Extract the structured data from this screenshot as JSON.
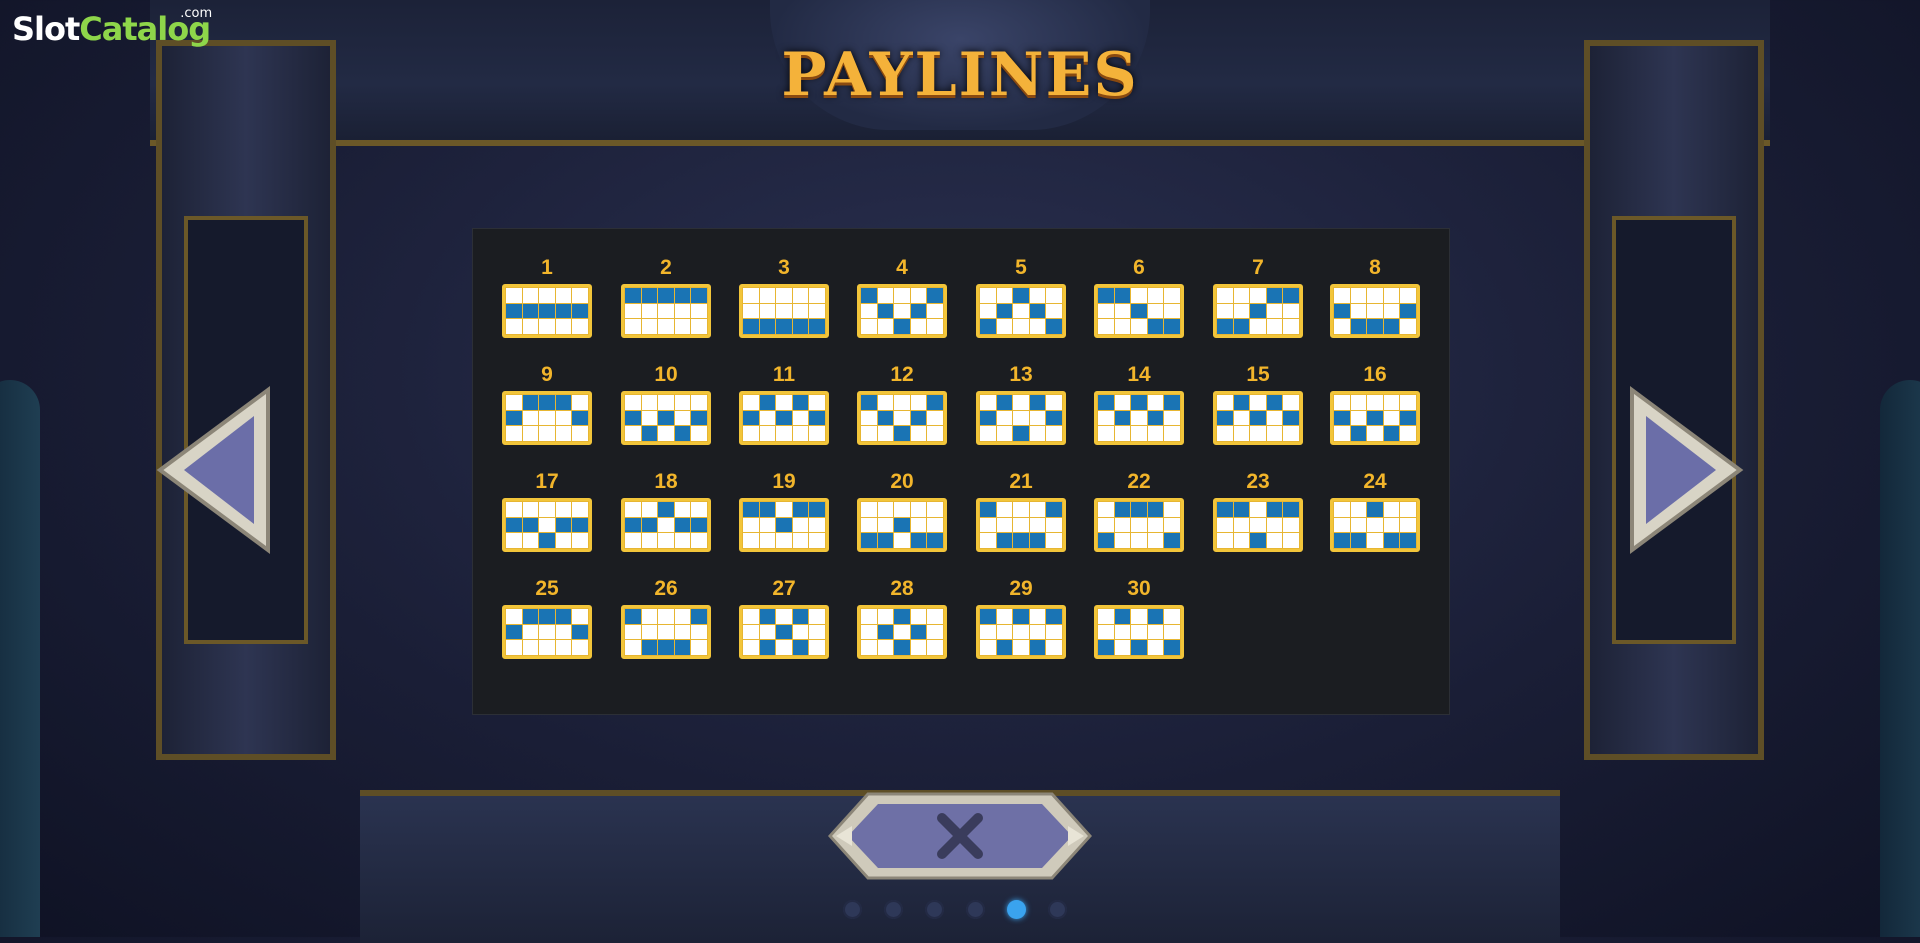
{
  "logo": {
    "part1": "Slot",
    "part2": "Catalog",
    "suffix": ".com"
  },
  "title": "PAYLINES",
  "paylines": [
    {
      "number": "1",
      "rows": [
        "00000",
        "11111",
        "00000"
      ]
    },
    {
      "number": "2",
      "rows": [
        "11111",
        "00000",
        "00000"
      ]
    },
    {
      "number": "3",
      "rows": [
        "00000",
        "00000",
        "11111"
      ]
    },
    {
      "number": "4",
      "rows": [
        "10001",
        "01010",
        "00100"
      ]
    },
    {
      "number": "5",
      "rows": [
        "00100",
        "01010",
        "10001"
      ]
    },
    {
      "number": "6",
      "rows": [
        "11000",
        "00100",
        "00011"
      ]
    },
    {
      "number": "7",
      "rows": [
        "00011",
        "00100",
        "11000"
      ]
    },
    {
      "number": "8",
      "rows": [
        "00000",
        "10001",
        "01110"
      ]
    },
    {
      "number": "9",
      "rows": [
        "01110",
        "10001",
        "00000"
      ]
    },
    {
      "number": "10",
      "rows": [
        "00000",
        "10101",
        "01010"
      ]
    },
    {
      "number": "11",
      "rows": [
        "01010",
        "10101",
        "00000"
      ]
    },
    {
      "number": "12",
      "rows": [
        "10001",
        "01010",
        "00100"
      ]
    },
    {
      "number": "13",
      "rows": [
        "01010",
        "10001",
        "00100"
      ]
    },
    {
      "number": "14",
      "rows": [
        "10101",
        "01010",
        "00000"
      ]
    },
    {
      "number": "15",
      "rows": [
        "01010",
        "10101",
        "00000"
      ]
    },
    {
      "number": "16",
      "rows": [
        "00000",
        "10101",
        "01010"
      ]
    },
    {
      "number": "17",
      "rows": [
        "00000",
        "11011",
        "00100"
      ]
    },
    {
      "number": "18",
      "rows": [
        "00100",
        "11011",
        "00000"
      ]
    },
    {
      "number": "19",
      "rows": [
        "11011",
        "00100",
        "00000"
      ]
    },
    {
      "number": "20",
      "rows": [
        "00000",
        "00100",
        "11011"
      ]
    },
    {
      "number": "21",
      "rows": [
        "10001",
        "00000",
        "01110"
      ]
    },
    {
      "number": "22",
      "rows": [
        "01110",
        "00000",
        "10001"
      ]
    },
    {
      "number": "23",
      "rows": [
        "11011",
        "00000",
        "00100"
      ]
    },
    {
      "number": "24",
      "rows": [
        "00100",
        "00000",
        "11011"
      ]
    },
    {
      "number": "25",
      "rows": [
        "01110",
        "10001",
        "00000"
      ]
    },
    {
      "number": "26",
      "rows": [
        "10001",
        "00000",
        "01110"
      ]
    },
    {
      "number": "27",
      "rows": [
        "01010",
        "00100",
        "01010"
      ]
    },
    {
      "number": "28",
      "rows": [
        "00100",
        "01010",
        "00100"
      ]
    },
    {
      "number": "29",
      "rows": [
        "10101",
        "00000",
        "01010"
      ]
    },
    {
      "number": "30",
      "rows": [
        "01010",
        "00000",
        "10101"
      ]
    }
  ],
  "colors": {
    "active_cell": "#1a74b4",
    "grid_border": "#f2c53a",
    "number": "#f2b52b"
  },
  "icons": {
    "prev": "left-triangle-arrow-icon",
    "next": "right-triangle-arrow-icon",
    "close": "x-close-icon"
  },
  "pagination": {
    "total": 6,
    "current": 5
  }
}
